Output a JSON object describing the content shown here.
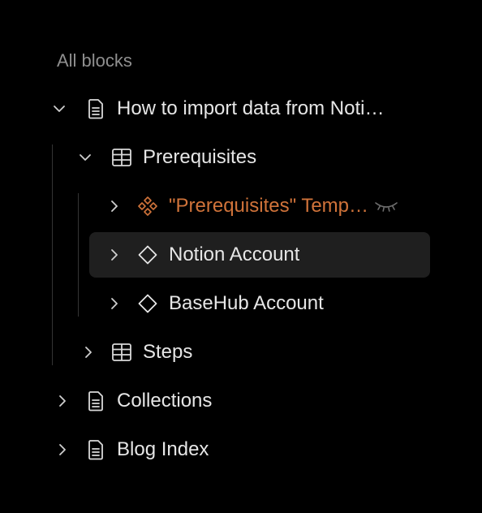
{
  "section": {
    "title": "All blocks"
  },
  "tree": {
    "doc_how_to_import": {
      "label": "How to import data from Noti…"
    },
    "prerequisites": {
      "label": "Prerequisites"
    },
    "prerequisites_template": {
      "label": "\"Prerequisites\" Temp…"
    },
    "notion_account": {
      "label": "Notion Account"
    },
    "basehub_account": {
      "label": "BaseHub Account"
    },
    "steps": {
      "label": "Steps"
    },
    "collections": {
      "label": "Collections"
    },
    "blog_index": {
      "label": "Blog Index"
    }
  },
  "icons": {
    "document": "document-icon",
    "table": "table-icon",
    "component": "component-icon",
    "template": "template-icon",
    "hidden": "eye-closed-icon",
    "expanded": "chevron-down-icon",
    "collapsed": "chevron-right-icon"
  },
  "colors": {
    "background": "#000000",
    "text": "#e6e6e6",
    "muted": "#8f8f8f",
    "accent": "#d0733a",
    "selected_row": "#1f1f1f",
    "guide_line": "#343434"
  }
}
